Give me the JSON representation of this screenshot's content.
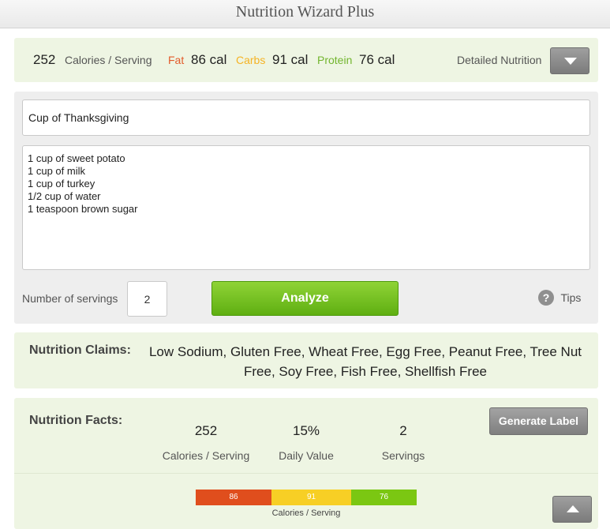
{
  "app": {
    "title": "Nutrition Wizard Plus"
  },
  "summary": {
    "calories_value": "252",
    "calories_label": "Calories / Serving",
    "fat_label": "Fat",
    "fat_value": "86 cal",
    "carbs_label": "Carbs",
    "carbs_value": "91 cal",
    "protein_label": "Protein",
    "protein_value": "76 cal",
    "detailed_label": "Detailed Nutrition"
  },
  "recipe": {
    "name": "Cup of Thanksgiving",
    "ingredients": [
      "1 cup of sweet potato",
      "1 cup of milk",
      "1 cup of turkey",
      "1/2 cup of water",
      "1 teaspoon brown sugar"
    ],
    "servings_label": "Number of servings",
    "servings_value": "2",
    "analyze_label": "Analyze",
    "tips_label": "Tips",
    "help_glyph": "?"
  },
  "claims": {
    "label": "Nutrition Claims:",
    "text": "Low Sodium, Gluten Free, Wheat Free, Egg Free, Peanut Free, Tree Nut Free, Soy Free, Fish Free, Shellfish Free"
  },
  "facts": {
    "label": "Nutrition Facts:",
    "calories_value": "252",
    "calories_label": "Calories / Serving",
    "daily_value": "15%",
    "daily_label": "Daily Value",
    "servings_value": "2",
    "servings_label": "Servings",
    "generate_label": "Generate Label",
    "bar": {
      "fat": "86",
      "carbs": "91",
      "protein": "76",
      "caption": "Calories / Serving"
    }
  },
  "colors": {
    "fat": "#e04e1d",
    "carbs": "#f7cf25",
    "protein": "#7bc712",
    "analyze": "#5faf12"
  },
  "icons": {
    "detailed_toggle": "chevron-down-icon",
    "collapse_toggle": "chevron-up-icon",
    "tips": "help-icon"
  }
}
